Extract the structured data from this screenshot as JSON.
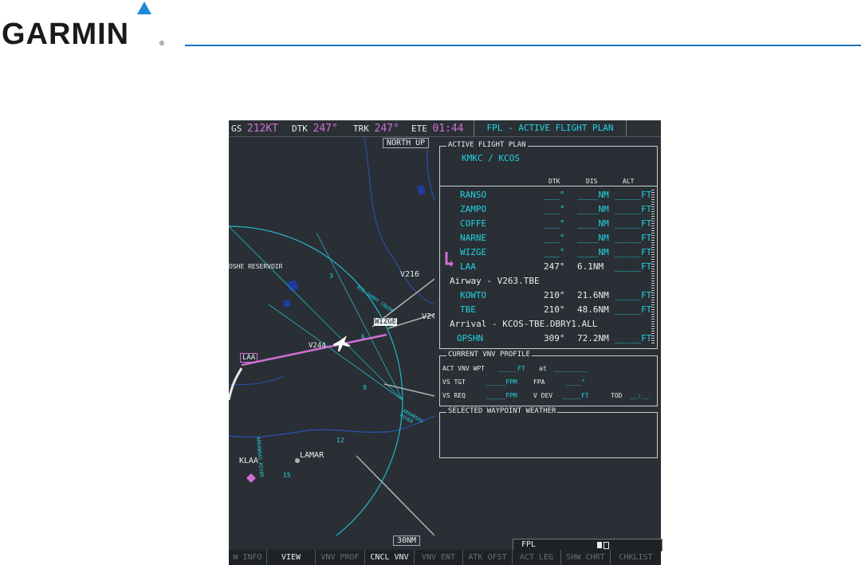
{
  "brand": {
    "name": "GARMIN",
    "reg": "®"
  },
  "topbar": {
    "gs_label": "GS",
    "gs_value": "212",
    "gs_unit": "KT",
    "dtk_label": "DTK",
    "dtk_value": "247°",
    "trk_label": "TRK",
    "trk_value": "247°",
    "ete_label": "ETE",
    "ete_value": "01:44",
    "page_title": "FPL - ACTIVE FLIGHT PLAN"
  },
  "map": {
    "orientation": "NORTH UP",
    "range": "30NM",
    "labels": {
      "reservoir": "OSHE RESERVOIR",
      "v216": "V216",
      "v24": "V24",
      "wizge": "WIZGE",
      "v244": "V244",
      "laa": "LAA",
      "klaa": "KLAA",
      "lamar": "LAMAR",
      "river": "ARKANSAS RIVER",
      "creek": "BIG SANDY CREEK",
      "river2": "ARKANSAS RIVER"
    },
    "ring_ticks": [
      "3",
      "6",
      "9",
      "12",
      "15"
    ]
  },
  "flight_plan": {
    "section_title": "ACTIVE FLIGHT PLAN",
    "route": "KMKC / KCOS",
    "columns": [
      "DTK",
      "DIS",
      "ALT"
    ],
    "rows": [
      {
        "wpt": "RANSO",
        "dtk": "___°",
        "dis": "____NM",
        "alt": "_____FT"
      },
      {
        "wpt": "ZAMPO",
        "dtk": "___°",
        "dis": "____NM",
        "alt": "_____FT"
      },
      {
        "wpt": "COFFE",
        "dtk": "___°",
        "dis": "____NM",
        "alt": "_____FT"
      },
      {
        "wpt": "NARNE",
        "dtk": "___°",
        "dis": "____NM",
        "alt": "_____FT"
      },
      {
        "wpt": "WIZGE",
        "dtk": "___°",
        "dis": "____NM",
        "alt": "_____FT"
      },
      {
        "wpt": "LAA",
        "dtk": "247°",
        "dis": "6.1NM",
        "alt": "_____FT"
      }
    ],
    "airway_label": "Airway - V263.TBE",
    "airway_rows": [
      {
        "wpt": "KOWTO",
        "dtk": "210°",
        "dis": "21.6NM",
        "alt": "_____FT"
      },
      {
        "wpt": "TBE",
        "dtk": "210°",
        "dis": "48.6NM",
        "alt": "_____FT"
      }
    ],
    "arrival_label": "Arrival - KCOS-TBE.DBRY1.ALL",
    "arrival_rows": [
      {
        "wpt": "OPSHN",
        "dtk": "309°",
        "dis": "72.2NM",
        "alt": "_____FT"
      }
    ]
  },
  "vnv": {
    "section_title": "CURRENT VNV PROFILE",
    "act_label": "ACT VNV WPT",
    "act_alt": "_____FT",
    "act_at": "at",
    "act_wpt": "_________",
    "vs_tgt_label": "VS TGT",
    "vs_tgt": "_____FPM",
    "fpa_label": "FPA",
    "fpa": "____°",
    "vs_req_label": "VS REQ",
    "vs_req": "_____FPM",
    "vdev_label": "V DEV",
    "vdev": "_____FT",
    "tod_label": "TOD",
    "tod": "__:__"
  },
  "weather": {
    "section_title": "SELECTED WAYPOINT WEATHER"
  },
  "fpl_status": {
    "label": "FPL"
  },
  "softkeys": [
    {
      "label": "W INFO",
      "active": false
    },
    {
      "label": "VIEW",
      "active": true
    },
    {
      "label": "VNV PROF",
      "active": false
    },
    {
      "label": "CNCL VNV",
      "active": true
    },
    {
      "label": "VNV ENT",
      "active": false
    },
    {
      "label": "ATK OFST",
      "active": false
    },
    {
      "label": "ACT LEG",
      "active": false
    },
    {
      "label": "SHW CHRT",
      "active": false
    },
    {
      "label": "CHKLIST",
      "active": false
    }
  ],
  "colors": {
    "cyan": "#22d3e0",
    "magenta": "#cf6fd6",
    "header_rule": "#1e6fc0",
    "logo_triangle": "#1e8ad8"
  }
}
